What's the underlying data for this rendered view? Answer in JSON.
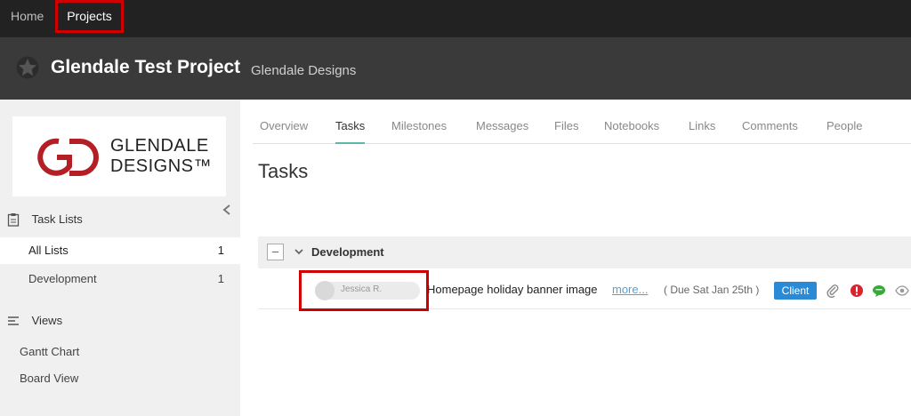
{
  "topnav": {
    "home": "Home",
    "projects": "Projects"
  },
  "header": {
    "title": "Glendale Test Project",
    "company": "Glendale Designs"
  },
  "logo": {
    "line1": "GLENDALE",
    "line2": "DESIGNS™"
  },
  "sidebar": {
    "task_lists_heading": "Task Lists",
    "lists": [
      {
        "label": "All Lists",
        "count": "1"
      },
      {
        "label": "Development",
        "count": "1"
      }
    ],
    "views_heading": "Views",
    "views": [
      {
        "label": "Gantt Chart"
      },
      {
        "label": "Board View"
      }
    ]
  },
  "tabs": [
    "Overview",
    "Tasks",
    "Milestones",
    "Messages",
    "Files",
    "Notebooks",
    "Links",
    "Comments",
    "People"
  ],
  "main": {
    "title": "Tasks",
    "group": {
      "name": "Development",
      "toggle": "–"
    },
    "task": {
      "assignee": "Jessica R.",
      "name": "Homepage holiday banner image",
      "more": "more...",
      "due": "( Due Sat Jan 25th )",
      "badge": "Client"
    }
  },
  "colors": {
    "accent_tab": "#5cb8a8",
    "badge": "#2b8ad6",
    "highlight": "#d10000",
    "alert": "#d9232d",
    "comment": "#3aa83a"
  }
}
